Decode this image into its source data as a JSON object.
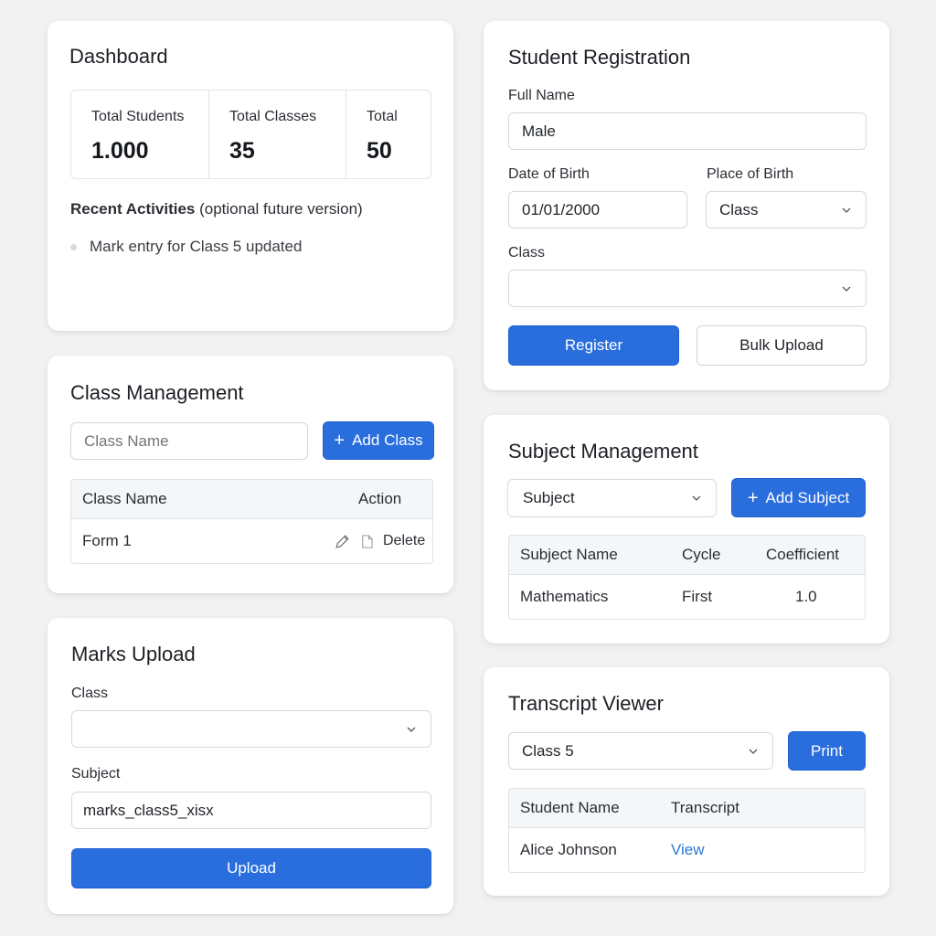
{
  "dashboard": {
    "title": "Dashboard",
    "stats": [
      {
        "label": "Total Students",
        "value": "1.000"
      },
      {
        "label": "Total Classes",
        "value": "35"
      },
      {
        "label": "Total",
        "value": "50"
      }
    ],
    "recent_heading": "Recent Activities",
    "recent_note": "(optional future version)",
    "activities": [
      "Mark entry for Class 5 updated"
    ]
  },
  "registration": {
    "title": "Student Registration",
    "full_name_label": "Full Name",
    "full_name_value": "Male",
    "dob_label": "Date of Birth",
    "dob_value": "01/01/2000",
    "pob_label": "Place of Birth",
    "pob_value": "Class",
    "class_label": "Class",
    "class_value": "",
    "register_button": "Register",
    "bulk_upload_button": "Bulk Upload"
  },
  "class_management": {
    "title": "Class Management",
    "input_placeholder": "Class Name",
    "add_button": "Add Class",
    "columns": [
      "Class Name",
      "Action"
    ],
    "rows": [
      {
        "name": "Form 1",
        "action": "Delete"
      }
    ]
  },
  "subject_management": {
    "title": "Subject Management",
    "select_value": "Subject",
    "add_button": "Add Subject",
    "columns": [
      "Subject Name",
      "Cycle",
      "Coefficient"
    ],
    "rows": [
      {
        "name": "Mathematics",
        "cycle": "First",
        "coefficient": "1.0"
      }
    ]
  },
  "marks_upload": {
    "title": "Marks Upload",
    "class_label": "Class",
    "class_value": "",
    "subject_label": "Subject",
    "subject_value": "marks_class5_xisx",
    "upload_button": "Upload"
  },
  "transcript_viewer": {
    "title": "Transcript Viewer",
    "class_select": "Class 5",
    "print_button": "Print",
    "columns": [
      "Student Name",
      "Transcript"
    ],
    "rows": [
      {
        "name": "Alice Johnson",
        "link": "View"
      }
    ]
  },
  "colors": {
    "primary": "#2a6ede",
    "link": "#2a7ad9",
    "background": "#f2f2f3"
  }
}
